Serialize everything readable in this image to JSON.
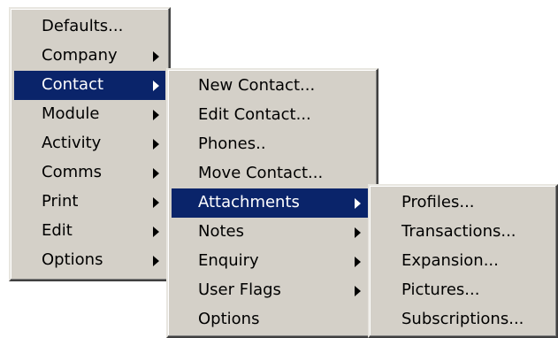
{
  "menu_main": {
    "items": [
      {
        "label": "Defaults..."
      },
      {
        "label": "Company"
      },
      {
        "label": "Contact"
      },
      {
        "label": "Module"
      },
      {
        "label": "Activity"
      },
      {
        "label": "Comms"
      },
      {
        "label": "Print"
      },
      {
        "label": "Edit"
      },
      {
        "label": "Options"
      }
    ],
    "selected": "Contact"
  },
  "menu_contact": {
    "items": [
      {
        "label": "New Contact..."
      },
      {
        "label": "Edit Contact..."
      },
      {
        "label": "Phones.."
      },
      {
        "label": "Move Contact..."
      },
      {
        "label": "Attachments"
      },
      {
        "label": "Notes"
      },
      {
        "label": "Enquiry"
      },
      {
        "label": "User Flags"
      },
      {
        "label": "Options"
      }
    ],
    "selected": "Attachments"
  },
  "menu_attachments": {
    "items": [
      {
        "label": "Profiles..."
      },
      {
        "label": "Transactions..."
      },
      {
        "label": "Expansion..."
      },
      {
        "label": "Pictures..."
      },
      {
        "label": "Subscriptions..."
      }
    ]
  },
  "colors": {
    "menu_face": "#d4d0c8",
    "highlight": "#0a246a",
    "highlight_text": "#ffffff",
    "text": "#000000"
  },
  "icons": {
    "submenu_arrow": "submenu-arrow-icon"
  }
}
